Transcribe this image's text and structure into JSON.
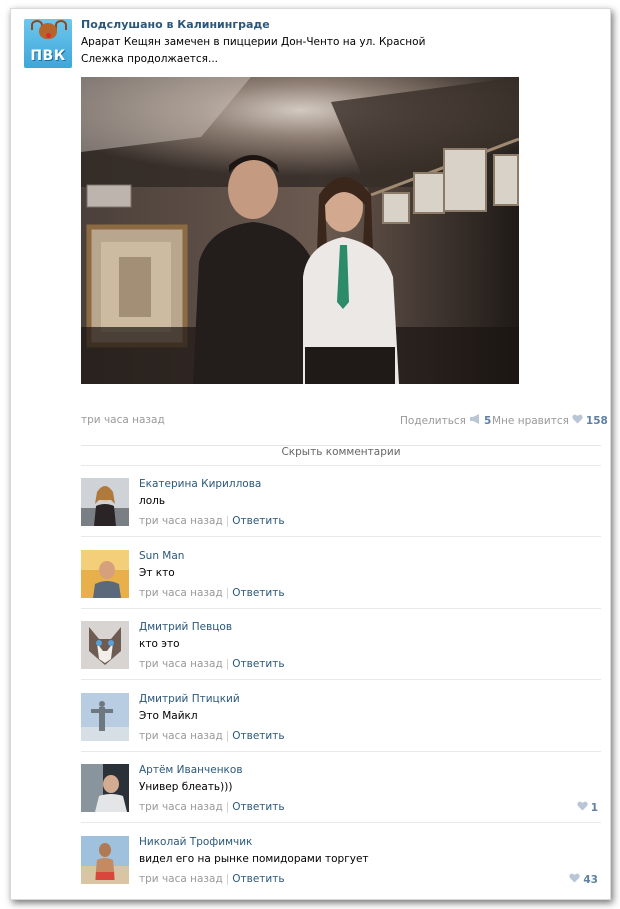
{
  "post": {
    "group_name": "Подслушано в Калининграде",
    "group_avatar_text": "ПВК",
    "text_line1": "Арарат Кещян замечен в пиццерии Дон-Ченто на ул. Красной",
    "text_line2": "Слежка продолжается...",
    "time": "три часа назад",
    "share_label": "Поделиться",
    "share_count": "5",
    "like_label": "Мне нравится",
    "like_count": "158",
    "hide_comments_label": "Скрыть комментарии"
  },
  "comments": [
    {
      "author": "Екатерина Кириллова",
      "text": "лоль",
      "time": "три часа назад",
      "reply": "Ответить",
      "likes": ""
    },
    {
      "author": "Sun Man",
      "text": "Эт кто",
      "time": "три часа назад",
      "reply": "Ответить",
      "likes": ""
    },
    {
      "author": "Дмитрий Певцов",
      "text": "кто это",
      "time": "три часа назад",
      "reply": "Ответить",
      "likes": ""
    },
    {
      "author": "Дмитрий Птицкий",
      "text": "Это Майкл",
      "time": "три часа назад",
      "reply": "Ответить",
      "likes": ""
    },
    {
      "author": "Артём Иванченков",
      "text": "Универ блеать)))",
      "time": "три часа назад",
      "reply": "Ответить",
      "likes": "1"
    },
    {
      "author": "Николай Трофимчик",
      "text": "видел его на рынке помидорами торгует",
      "time": "три часа назад",
      "reply": "Ответить",
      "likes": "43"
    }
  ],
  "colors": {
    "link": "#2b587a",
    "muted": "#999999",
    "count": "#5f7fa3"
  },
  "icons": [
    "megaphone-icon",
    "heart-icon"
  ]
}
